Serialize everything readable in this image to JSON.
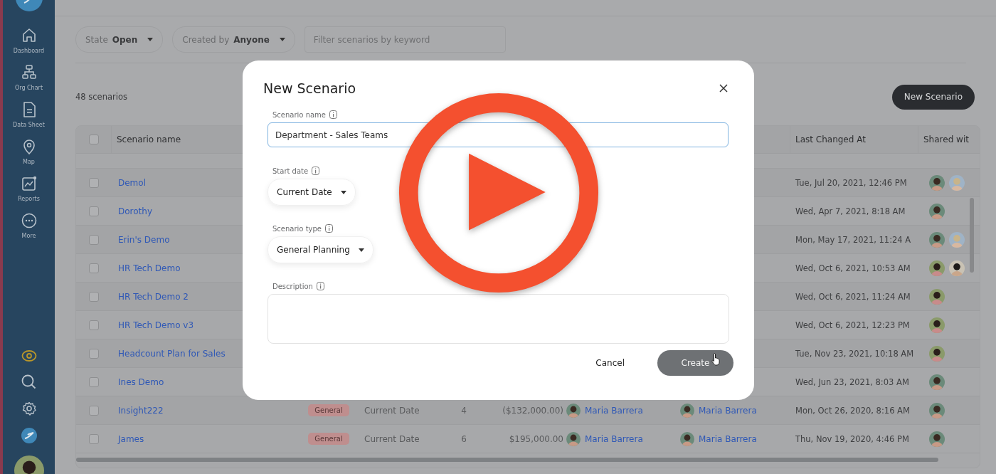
{
  "sidebar": {
    "items": [
      {
        "label": "Dashboard"
      },
      {
        "label": "Org Chart"
      },
      {
        "label": "Data Sheet"
      },
      {
        "label": "Map"
      },
      {
        "label": "Reports"
      },
      {
        "label": "More"
      }
    ]
  },
  "filters": [
    {
      "label": "State",
      "value": "Open"
    },
    {
      "label": "Created by",
      "value": "Anyone"
    }
  ],
  "search": {
    "placeholder": "Filter scenarios by keyword"
  },
  "count": "48 scenarios",
  "new_button": "New Scenario",
  "table": {
    "header_checked": false,
    "columns": [
      "Scenario name",
      "Last Changed At",
      "Shared wit"
    ],
    "rows": [
      {
        "name": "Demol",
        "checked": false,
        "last_changed": "Tue, Jul 20, 2021, 12:46 PM",
        "shared_with": [
          {
            "kind": "brunette"
          },
          {
            "kind": "blond"
          }
        ]
      },
      {
        "name": "Dorothy",
        "checked": false,
        "last_changed": "Wed, Apr 7, 2021, 8:18 AM",
        "shared_with": [
          {
            "kind": "brunette"
          }
        ]
      },
      {
        "name": "Erin's Demo",
        "checked": false,
        "last_changed": "Mon, May 17, 2021, 11:24 A",
        "shared_with": [
          {
            "kind": "brunette"
          },
          {
            "kind": "blond"
          }
        ]
      },
      {
        "name": "HR Tech Demo",
        "checked": false,
        "last_changed": "Wed, Oct 6, 2021, 10:53 AM",
        "shared_with": [
          {
            "kind": "bearded"
          },
          {
            "kind": "darkhair"
          }
        ]
      },
      {
        "name": "HR Tech Demo 2",
        "checked": false,
        "last_changed": "Wed, Oct 6, 2021, 11:24 AM",
        "shared_with": [
          {
            "kind": "bearded"
          }
        ]
      },
      {
        "name": "HR Tech Demo v3",
        "checked": false,
        "last_changed": "Wed, Oct 6, 2021, 12:23 PM",
        "shared_with": [
          {
            "kind": "bearded"
          }
        ]
      },
      {
        "name": "Headcount Plan for Sales",
        "checked": false,
        "last_changed": "Tue, Nov 23, 2021, 10:18 AM",
        "shared_with": [
          {
            "kind": "bearded"
          }
        ]
      },
      {
        "name": "Ines Demo",
        "checked": false,
        "last_changed": "Wed, Jun 23, 2021, 8:03 AM",
        "shared_with": [
          {
            "kind": "brunette"
          }
        ]
      },
      {
        "name": "Insight222",
        "checked": false,
        "tag": "General",
        "start": "Current Date",
        "column_5": "4",
        "amount": "($132,000.00)",
        "created_by": "Maria Barrera",
        "modified_by": "Maria Barrera",
        "last_changed": "Mon, Oct 26, 2020, 8:16 AM",
        "shared_with": [
          {
            "kind": "brunette"
          }
        ]
      },
      {
        "name": "James",
        "checked": false,
        "tag": "General",
        "start": "Current Date",
        "column_5": "6",
        "amount": "$195,000.00",
        "created_by": "Maria Barrera",
        "modified_by": "Maria Barrera",
        "last_changed": "Thu, Nov 19, 2020, 4:46 PM",
        "shared_with": [
          {
            "kind": "brunette"
          }
        ]
      }
    ]
  },
  "dialog": {
    "title": "New Scenario",
    "fields": [
      {
        "kind": "text",
        "label": "Scenario name",
        "value": "Department - Sales Teams",
        "focused": true
      },
      {
        "kind": "select",
        "label": "Start date",
        "value": "Current Date"
      },
      {
        "kind": "select",
        "label": "Scenario type",
        "value": "General Planning"
      },
      {
        "kind": "textarea",
        "label": "Description"
      }
    ],
    "buttons": [
      {
        "kind": "text",
        "label": "Cancel"
      },
      {
        "kind": "primary",
        "label": "Create"
      }
    ]
  }
}
